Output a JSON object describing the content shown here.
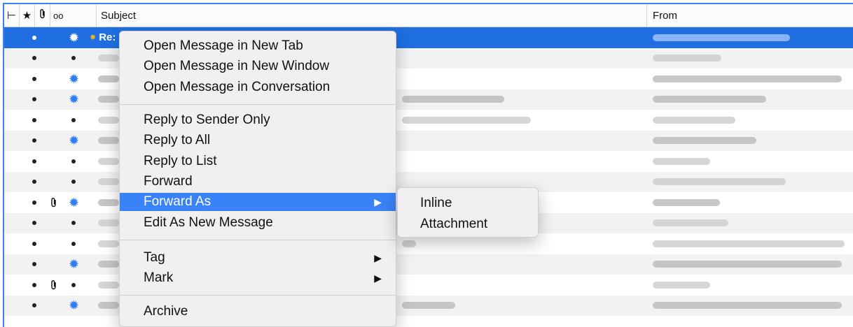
{
  "header": {
    "thread_icon": "thread-icon",
    "star_icon": "star-icon",
    "attachment_icon": "paperclip-icon",
    "read_icon": "glasses-icon",
    "subject_label": "Subject",
    "from_label": "From"
  },
  "selected_row": {
    "subject_prefix": "Re:"
  },
  "context_menu": {
    "open_new_tab": "Open Message in New Tab",
    "open_new_window": "Open Message in New Window",
    "open_conversation": "Open Message in Conversation",
    "reply_sender": "Reply to Sender Only",
    "reply_all": "Reply to All",
    "reply_list": "Reply to List",
    "forward": "Forward",
    "forward_as": "Forward As",
    "edit_new": "Edit As New Message",
    "tag": "Tag",
    "mark": "Mark",
    "archive": "Archive",
    "submenu_arrow": "▶"
  },
  "forward_submenu": {
    "inline": "Inline",
    "attachment": "Attachment"
  },
  "colors": {
    "selection": "#1f6fe0",
    "menu_highlight": "#3a82f7",
    "unread_star": "#2f7df6"
  }
}
